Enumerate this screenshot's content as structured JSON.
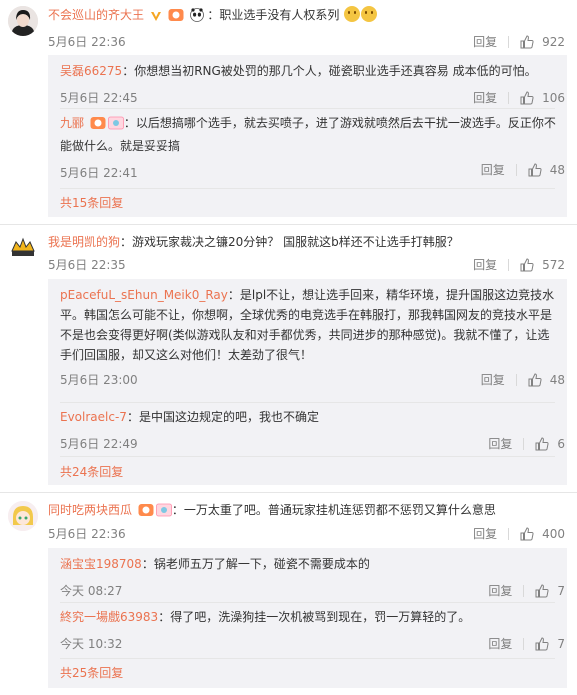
{
  "colors": {
    "username": "#eb7350",
    "meta": "#808080",
    "reply_bg": "#f2f2f5"
  },
  "comments": [
    {
      "username": "不会巡山的齐大王",
      "text": "：职业选手没有人权系列",
      "time": "5月6日 22:36",
      "reply_label": "回复",
      "likes": "922",
      "icons": [
        "vip-v-icon",
        "member-badge-icon",
        "panda-icon",
        "smile-emoji-icon",
        "smile-emoji-icon"
      ],
      "replies": [
        {
          "username": "吴磊66275",
          "text": "：你想想当初RNG被处罚的那几个人，碰瓷职业选手还真容易 成本低的可怕。",
          "time": "5月6日 22:45",
          "reply_label": "回复",
          "likes": "106"
        },
        {
          "username": "九郦",
          "text_line1": "：以后想搞哪个选手，就去买喷子，进了游戏就喷然后去干扰一波选手。反正你不",
          "text_line2": "能做什么。就是妥妥搞",
          "time": "5月6日 22:41",
          "reply_label": "回复",
          "likes": "48"
        }
      ],
      "more": "共15条回复"
    },
    {
      "username": "我是明凯的狗",
      "text": "：游戏玩家裁决之镰20分钟？ 国服就这b样还不让选手打韩服？",
      "time": "5月6日 22:35",
      "reply_label": "回复",
      "likes": "572",
      "replies": [
        {
          "username": "pEacefuL_sEhun_Meik0_Ray",
          "text_line1": "：是lpl不让，想让选手回来，精华环境，提升国服这边竞技水",
          "text_line2": "平。韩国怎么可能不让，你想啊，全球优秀的电竞选手在韩服打，那我韩国网友的竞技水平是",
          "text_line3": "不是也会变得更好啊(类似游戏队友和对手都优秀，共同进步的那种感觉)。我就不懂了，让选",
          "text_line4": "手们回国服，却又这么对他们！太差劲了很气！",
          "time": "5月6日 23:00",
          "reply_label": "回复",
          "likes": "48"
        },
        {
          "username": "Evolraelc-7",
          "text": "：是中国这边规定的吧，我也不确定",
          "time": "5月6日 22:49",
          "reply_label": "回复",
          "likes": "6"
        }
      ],
      "more": "共24条回复"
    },
    {
      "username": "同时吃两块西瓜",
      "text": "：一万太重了吧。普通玩家挂机连惩罚都不惩罚又算什么意思",
      "time": "5月6日 22:36",
      "reply_label": "回复",
      "likes": "400",
      "replies": [
        {
          "username": "涵宝宝198708",
          "text": "：锅老师五万了解一下，碰瓷不需要成本的",
          "time": "今天 08:27",
          "reply_label": "回复",
          "likes": "7"
        },
        {
          "username": "終究一場戲63983",
          "text": "：得了吧，洗澡狗挂一次机被骂到现在，罚一万算轻的了。",
          "time": "今天 10:32",
          "reply_label": "回复",
          "likes": "7"
        }
      ],
      "more": "共25条回复"
    }
  ]
}
